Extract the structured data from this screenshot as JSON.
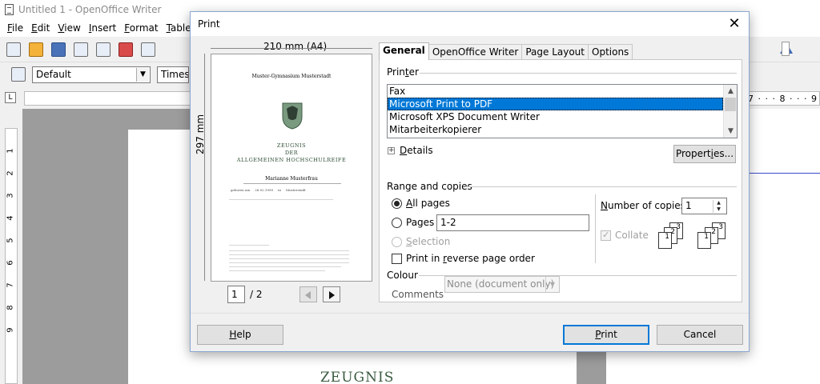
{
  "app": {
    "title": "Untitled 1 - OpenOffice Writer",
    "menu": [
      {
        "u": "F",
        "rest": "ile"
      },
      {
        "u": "E",
        "rest": "dit"
      },
      {
        "u": "V",
        "rest": "iew"
      },
      {
        "u": "I",
        "rest": "nsert"
      },
      {
        "u": "F",
        "rest": "ormat"
      },
      {
        "u": "T",
        "rest": "able"
      }
    ],
    "paragraph_style": "Default",
    "font_name": "Times",
    "ruler_numbers": "6 · · · 7 · · · 8 · · · 9",
    "vertical_ruler": [
      "1",
      "2",
      "3",
      "4",
      "5",
      "6",
      "7",
      "8",
      "9"
    ],
    "page_heading": "ZEUGNIS"
  },
  "dialog": {
    "title": "Print",
    "close_glyph": "✕",
    "preview": {
      "width_label": "210 mm (A4)",
      "height_label": "297 mm",
      "school": "Muster-Gymnasium Musterstadt",
      "doc_line1": "ZEUGNIS",
      "doc_line2": "DER",
      "doc_line3": "ALLGEMEINEN HOCHSCHULREIFE",
      "student": "Marianne Musterfrau",
      "birth_label": "geboren am",
      "birth_date": "28.02.1999",
      "birth_in": "in",
      "birth_place": "Musterstadt",
      "current_page": "1",
      "total_pages": "/ 2"
    },
    "tabs": [
      "General",
      "OpenOffice Writer",
      "Page Layout",
      "Options"
    ],
    "printer": {
      "label_pre": "Prin",
      "label_u": "t",
      "label_post": "er",
      "items": [
        "Fax",
        "Microsoft Print to PDF",
        "Microsoft XPS Document Writer",
        "Mitarbeiterkopierer"
      ],
      "selected": "Microsoft Print to PDF",
      "details_u": "D",
      "details_rest": "etails",
      "properties_pre": "Propert",
      "properties_u": "i",
      "properties_post": "es..."
    },
    "range": {
      "label": "Range and copies",
      "all_pages_u": "A",
      "all_pages_rest": "ll pages",
      "pages_label": "Pages",
      "pages_value": "1-2",
      "selection_u": "S",
      "selection_rest": "election",
      "reverse_pre": "Print in ",
      "reverse_u": "r",
      "reverse_post": "everse page order",
      "copies_u": "N",
      "copies_rest": "umber of copies",
      "copies_value": "1",
      "collate": "Collate"
    },
    "colour": {
      "label": "Colour",
      "comments_label": "Comments",
      "comments_value": "None (document only)"
    },
    "buttons": {
      "help_u": "H",
      "help_rest": "elp",
      "print_u": "P",
      "print_rest": "rint",
      "cancel": "Cancel"
    }
  }
}
